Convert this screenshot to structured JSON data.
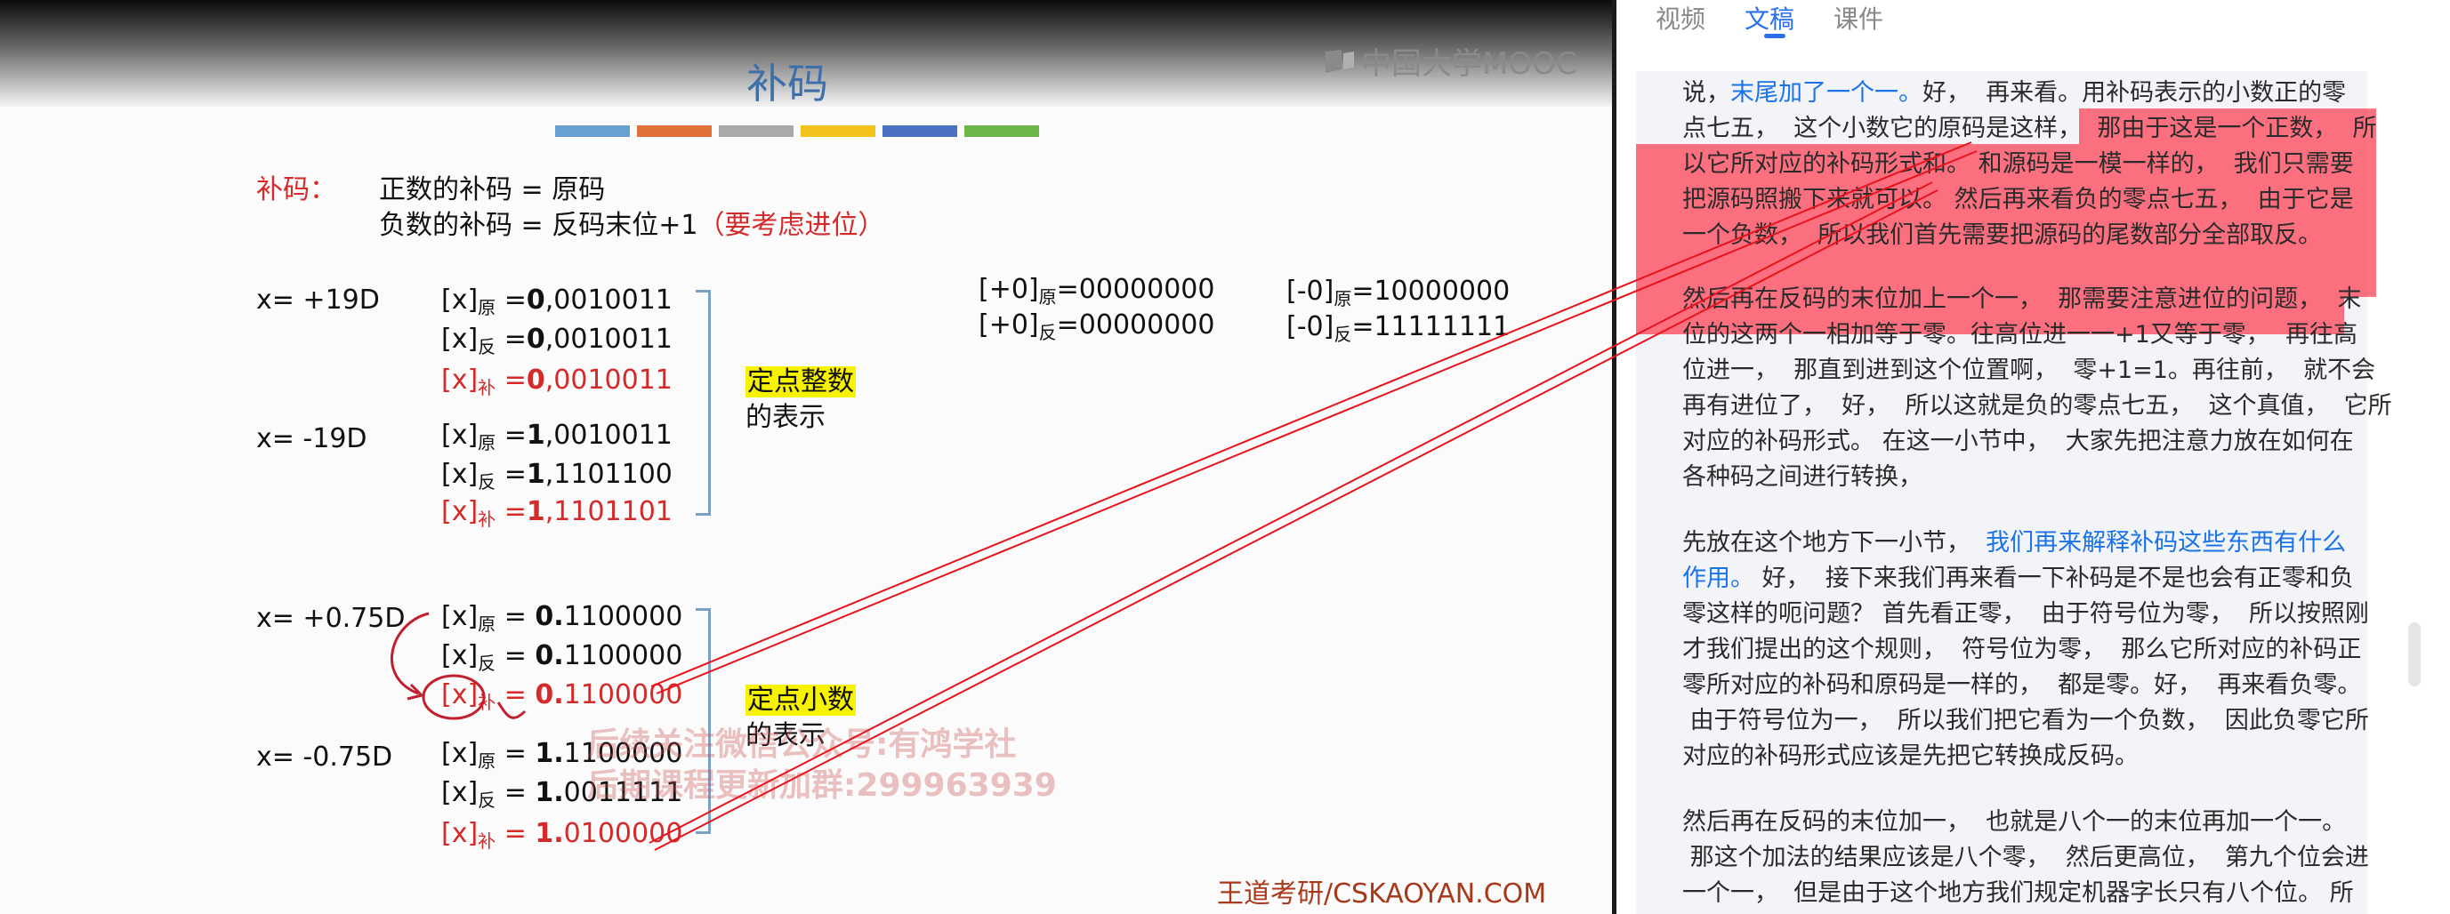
{
  "video": {
    "slide_title": "补码",
    "mooc_logo": "中国大学MOOC",
    "color_bar": [
      "#6a9fd2",
      "#e0703a",
      "#a9a9a9",
      "#f2c21a",
      "#4a72c0",
      "#6cb548"
    ],
    "def_label": "补码：",
    "def_line1": "正数的补码 = 原码",
    "def_line2_a": "负数的补码 = 反码末位+1",
    "def_line2_b": "（要考虑进位）",
    "int_section": {
      "x1": "x= +19D",
      "x1_rows": [
        {
          "pre": "[x]",
          "sub": "原",
          "eq": " =",
          "bit": "0",
          "rest": ",0010011"
        },
        {
          "pre": "[x]",
          "sub": "反",
          "eq": " =",
          "bit": "0",
          "rest": ",0010011"
        },
        {
          "pre": "[x]",
          "sub": "补",
          "eq": " =",
          "bit": "0",
          "rest": ",0010011"
        }
      ],
      "x2": "x= -19D",
      "x2_rows": [
        {
          "pre": "[x]",
          "sub": "原",
          "eq": " =",
          "bit": "1",
          "rest": ",0010011"
        },
        {
          "pre": "[x]",
          "sub": "反",
          "eq": " =",
          "bit": "1",
          "rest": ",1101100"
        },
        {
          "pre": "[x]",
          "sub": "补",
          "eq": " =",
          "bit": "1",
          "rest": ",1101101"
        }
      ],
      "label_hl": "定点整数",
      "label_rest": "的表示"
    },
    "zero": {
      "pos_orig": {
        "pre": "[+0]",
        "sub": "原",
        "val": "=00000000"
      },
      "pos_inv": {
        "pre": "[+0]",
        "sub": "反",
        "val": "=00000000"
      },
      "neg_orig": {
        "pre": "[-0]",
        "sub": "原",
        "val": "=10000000"
      },
      "neg_inv": {
        "pre": "[-0]",
        "sub": "反",
        "val": "=11111111"
      }
    },
    "frac_section": {
      "x1": "x= +0.75D",
      "x1_rows": [
        {
          "pre": "[x]",
          "sub": "原",
          "eq": " = ",
          "bit": "0.",
          "rest": "1100000"
        },
        {
          "pre": "[x]",
          "sub": "反",
          "eq": " = ",
          "bit": "0.",
          "rest": "1100000"
        },
        {
          "pre": "[x]",
          "sub": "补",
          "eq": " = ",
          "bit": "0.",
          "rest": "1100000"
        }
      ],
      "x2": "x= -0.75D",
      "x2_rows": [
        {
          "pre": "[x]",
          "sub": "原",
          "eq": " = ",
          "bit": "1.",
          "rest": "1100000"
        },
        {
          "pre": "[x]",
          "sub": "反",
          "eq": " = ",
          "bit": "1.",
          "rest": "0011111"
        },
        {
          "pre": "[x]",
          "sub": "补",
          "eq": " = ",
          "bit": "1.",
          "rest": "0100000"
        }
      ],
      "label_hl": "定点小数",
      "label_rest": "的表示"
    },
    "watermark_line1": "后续关注微信公众号:有鸿学社",
    "watermark_line2": "后期课程更新加群:299963939",
    "credit": "王道考研/CSKAOYAN.COM"
  },
  "panel": {
    "tabs": [
      {
        "label": "视频",
        "active": false
      },
      {
        "label": "文稿",
        "active": true
      },
      {
        "label": "课件",
        "active": false
      }
    ],
    "para1": {
      "l1_a": "说，",
      "l1_b": "末尾加了一个一。",
      "l1_c": "好，  再来看。用补码表示的小数正的零",
      "l2": "点七五，  这个小数它的原码是这样，  那由于这是一个正数，  所",
      "l3": "以它所对应的补码形式和。 和源码是一模一样的，  我们只需要",
      "l4": "把源码照搬下来就可以。 然后再来看负的零点七五，  由于它是",
      "l5": "一个负数，  所以我们首先需要把源码的尾数部分全部取反。"
    },
    "para2": [
      "然后再在反码的末位加上一个一，  那需要注意进位的问题，  末",
      "位的这两个一相加等于零。往高位进一一+1又等于零，  再往高",
      "位进一，  那直到进到这个位置啊，  零+1=1。再往前，  就不会",
      "再有进位了，  好，  所以这就是负的零点七五，  这个真值，  它所",
      "对应的补码形式。 在这一小节中，  大家先把注意力放在如何在",
      "各种码之间进行转换，"
    ],
    "para3": {
      "l1_a": "先放在这个地方下一小节，  ",
      "l1_b": "我们再来解释补码这些东西有什么",
      "l2_a": "作用。",
      "l2_b": " 好，  接下来我们再来看一下补码是不是也会有正零和负",
      "rest": [
        "零这样的呃问题？ 首先看正零，  由于符号位为零，  所以按照刚",
        "才我们提出的这个规则，  符号位为零，  那么它所对应的补码正",
        "零所对应的补码和原码是一样的，  都是零。好，  再来看负零。",
        " 由于符号位为一，  所以我们把它看为一个负数，  因此负零它所",
        "对应的补码形式应该是先把它转换成反码。"
      ]
    },
    "para4": [
      "然后再在反码的末位加一，  也就是八个一的末位再加一个一。",
      " 那这个加法的结果应该是八个零，  然后更高位，  第九个位会进",
      "一个一，  但是由于这个地方我们规定机器字长只有八个位。 所"
    ]
  },
  "colors": {
    "highlight_red": "#ff3c50",
    "link_blue": "#1a73e8",
    "slide_title_blue": "#3f6fa8",
    "yellow_highlight": "#f6f200"
  }
}
